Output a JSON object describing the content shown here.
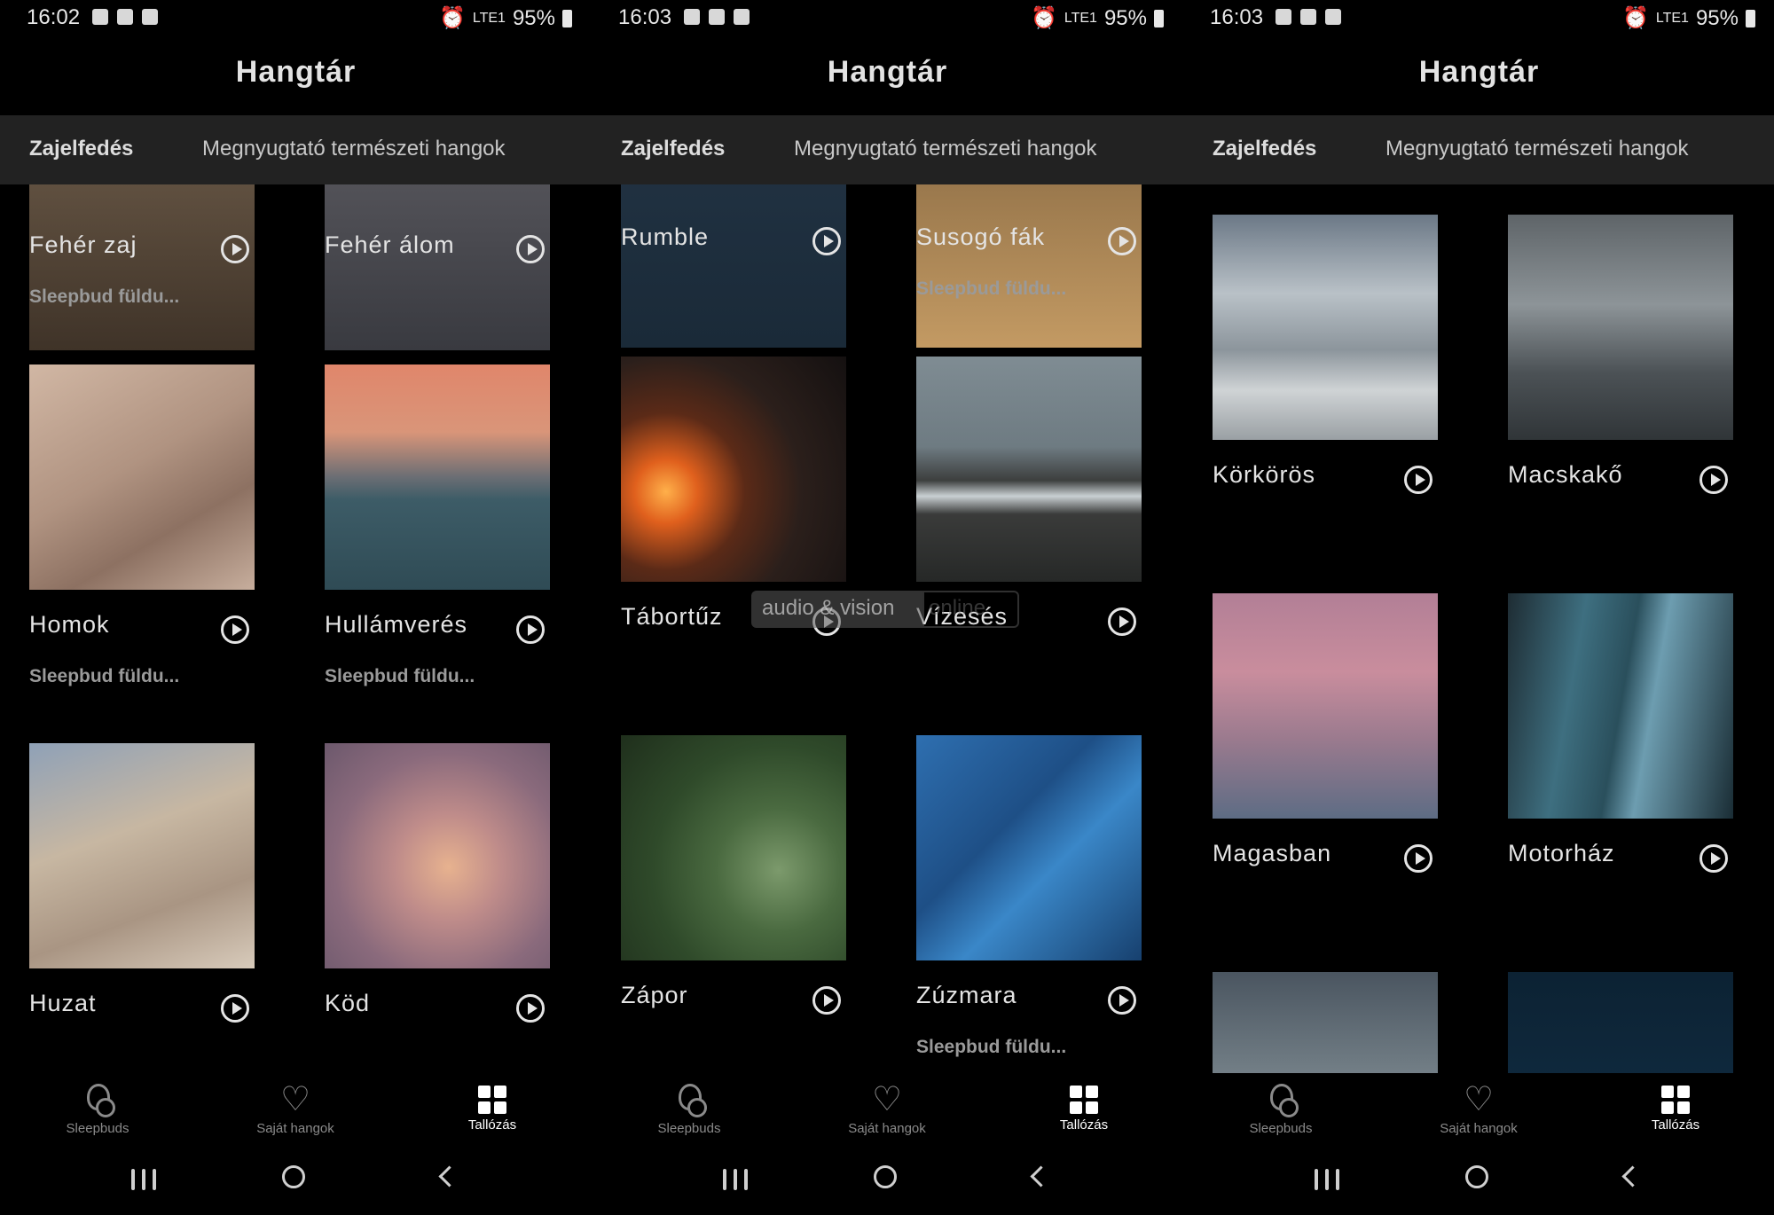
{
  "app": {
    "title": "Hangtár",
    "tabs": [
      "Zajelfedés",
      "Megnyugtató természeti hangok"
    ],
    "nav": [
      "Sleepbuds",
      "Saját hangok",
      "Tallózás"
    ]
  },
  "screens": [
    {
      "status": {
        "time": "16:02",
        "battery": "95%"
      },
      "cards": [
        {
          "name": "Fehér zaj",
          "sub": "Sleepbud füldu..."
        },
        {
          "name": "Fehér álom",
          "sub": ""
        },
        {
          "name": "Homok",
          "sub": "Sleepbud füldu..."
        },
        {
          "name": "Hullámverés",
          "sub": "Sleepbud füldu..."
        },
        {
          "name": "Huzat",
          "sub": ""
        },
        {
          "name": "Köd",
          "sub": ""
        }
      ]
    },
    {
      "status": {
        "time": "16:03",
        "battery": "95%"
      },
      "cards": [
        {
          "name": "Rumble",
          "sub": ""
        },
        {
          "name": "Susogó fák",
          "sub": "Sleepbud füldu..."
        },
        {
          "name": "Tábortűz",
          "sub": ""
        },
        {
          "name": "Vízesés",
          "sub": ""
        },
        {
          "name": "Zápor",
          "sub": ""
        },
        {
          "name": "Zúzmara",
          "sub": "Sleepbud füldu..."
        }
      ]
    },
    {
      "status": {
        "time": "16:03",
        "battery": "95%"
      },
      "cards": [
        {
          "name": "Körkörös",
          "sub": ""
        },
        {
          "name": "Macskakő",
          "sub": ""
        },
        {
          "name": "Magasban",
          "sub": ""
        },
        {
          "name": "Motorház",
          "sub": ""
        }
      ]
    }
  ],
  "watermark": {
    "left": "audio & vision",
    "right": "online"
  },
  "status_icons": {
    "mini": "LTE1"
  },
  "icons": {
    "nav": [
      "sleepbuds-icon",
      "heart-icon",
      "grid-icon"
    ],
    "heart_glyph": "♡"
  },
  "colors": {
    "background": "#000000",
    "tabbar": "#222222",
    "text": "#e4e4e4",
    "subtext": "#9a9a9a",
    "nav_inactive": "#8a8a8a"
  }
}
